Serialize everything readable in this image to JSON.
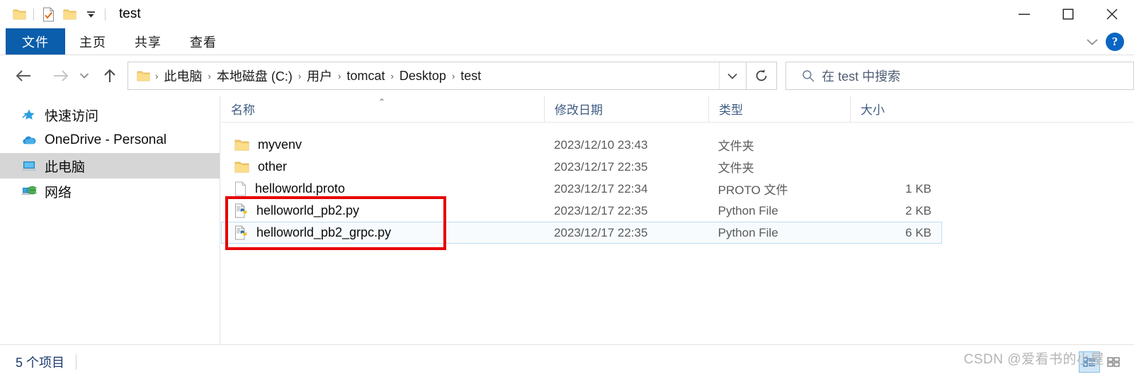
{
  "window": {
    "title": "test",
    "quick_access": [
      {
        "name": "folder-icon",
        "label": "文件夹"
      },
      {
        "name": "properties-icon",
        "label": "属性"
      },
      {
        "name": "new-folder-icon",
        "label": "新建文件夹"
      },
      {
        "name": "customize-qat-icon",
        "label": "自定义快速访问工具栏"
      }
    ],
    "controls": {
      "minimize": "最小化",
      "maximize": "最大化",
      "close": "关闭"
    }
  },
  "ribbon": {
    "tabs": [
      {
        "label": "文件",
        "active": true
      },
      {
        "label": "主页",
        "active": false
      },
      {
        "label": "共享",
        "active": false
      },
      {
        "label": "查看",
        "active": false
      }
    ],
    "collapse_label": "展开功能区",
    "help_label": "?"
  },
  "nav": {
    "back": "后退",
    "forward": "前进",
    "recent": "最近浏览的位置",
    "up": "上移到",
    "refresh": "刷新",
    "dropdown": "历史记录"
  },
  "address": {
    "crumbs": [
      "此电脑",
      "本地磁盘 (C:)",
      "用户",
      "tomcat",
      "Desktop",
      "test"
    ],
    "separator": "›"
  },
  "search": {
    "placeholder": "在 test 中搜索",
    "icon": "search-icon"
  },
  "sidebar": {
    "items": [
      {
        "label": "快速访问",
        "icon": "star-pin-icon",
        "selected": false
      },
      {
        "label": "OneDrive - Personal",
        "icon": "onedrive-cloud-icon",
        "selected": false
      },
      {
        "label": "此电脑",
        "icon": "this-pc-icon",
        "selected": true
      },
      {
        "label": "网络",
        "icon": "network-icon",
        "selected": false
      }
    ]
  },
  "filelist": {
    "columns": [
      {
        "label": "名称",
        "sorted": "asc"
      },
      {
        "label": "修改日期",
        "sorted": ""
      },
      {
        "label": "类型",
        "sorted": ""
      },
      {
        "label": "大小",
        "sorted": ""
      }
    ],
    "sort_caret": "⌃",
    "rows": [
      {
        "name": "myvenv",
        "date": "2023/12/10 23:43",
        "type": "文件夹",
        "size": "",
        "icon": "folder-icon",
        "hover": false
      },
      {
        "name": "other",
        "date": "2023/12/17 22:35",
        "type": "文件夹",
        "size": "",
        "icon": "folder-icon",
        "hover": false
      },
      {
        "name": "helloworld.proto",
        "date": "2023/12/17 22:34",
        "type": "PROTO 文件",
        "size": "1 KB",
        "icon": "generic-file-icon",
        "hover": false
      },
      {
        "name": "helloworld_pb2.py",
        "date": "2023/12/17 22:35",
        "type": "Python File",
        "size": "2 KB",
        "icon": "python-file-icon",
        "hover": false
      },
      {
        "name": "helloworld_pb2_grpc.py",
        "date": "2023/12/17 22:35",
        "type": "Python File",
        "size": "6 KB",
        "icon": "python-file-icon",
        "hover": true
      }
    ]
  },
  "annotation": {
    "color": "#e60000",
    "label": "红色标注框"
  },
  "statusbar": {
    "item_count": "5 个项目",
    "view_details": "详细信息",
    "view_large_icons": "大图标"
  },
  "watermark": {
    "text": "CSDN @爱看书的小屋"
  },
  "colors": {
    "accent": "#0b5eab",
    "selection": "#d6d6d6",
    "hover_row": "#f7fbfe",
    "hover_border": "#bcdcf2",
    "annotation": "#e60000",
    "header_text": "#3f5b82"
  }
}
